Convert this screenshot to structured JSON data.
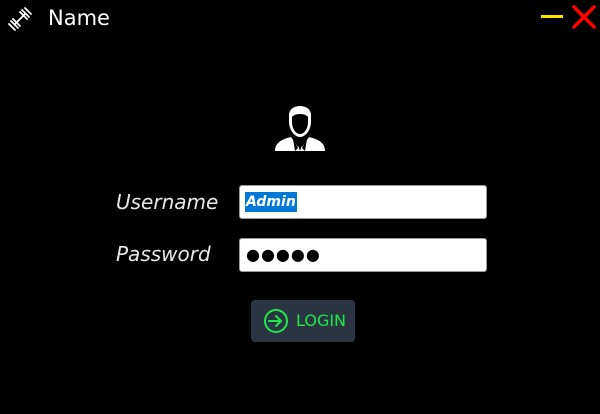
{
  "window": {
    "title": "Name",
    "app_icon": "dumbbell-icon",
    "minimize_icon": "minimize-icon",
    "close_icon": "close-icon"
  },
  "colors": {
    "background": "#000000",
    "minimize": "#ffe100",
    "close": "#ff0000",
    "login_text": "#1ee84c",
    "login_bg": "#2b3542",
    "selection": "#0078d7"
  },
  "form": {
    "avatar_icon": "user-icon",
    "username": {
      "label": "Username",
      "value": "Admin"
    },
    "password": {
      "label": "Password",
      "value": "●●●●●"
    },
    "login": {
      "label": "LOGIN",
      "icon": "login-arrow-icon"
    }
  }
}
